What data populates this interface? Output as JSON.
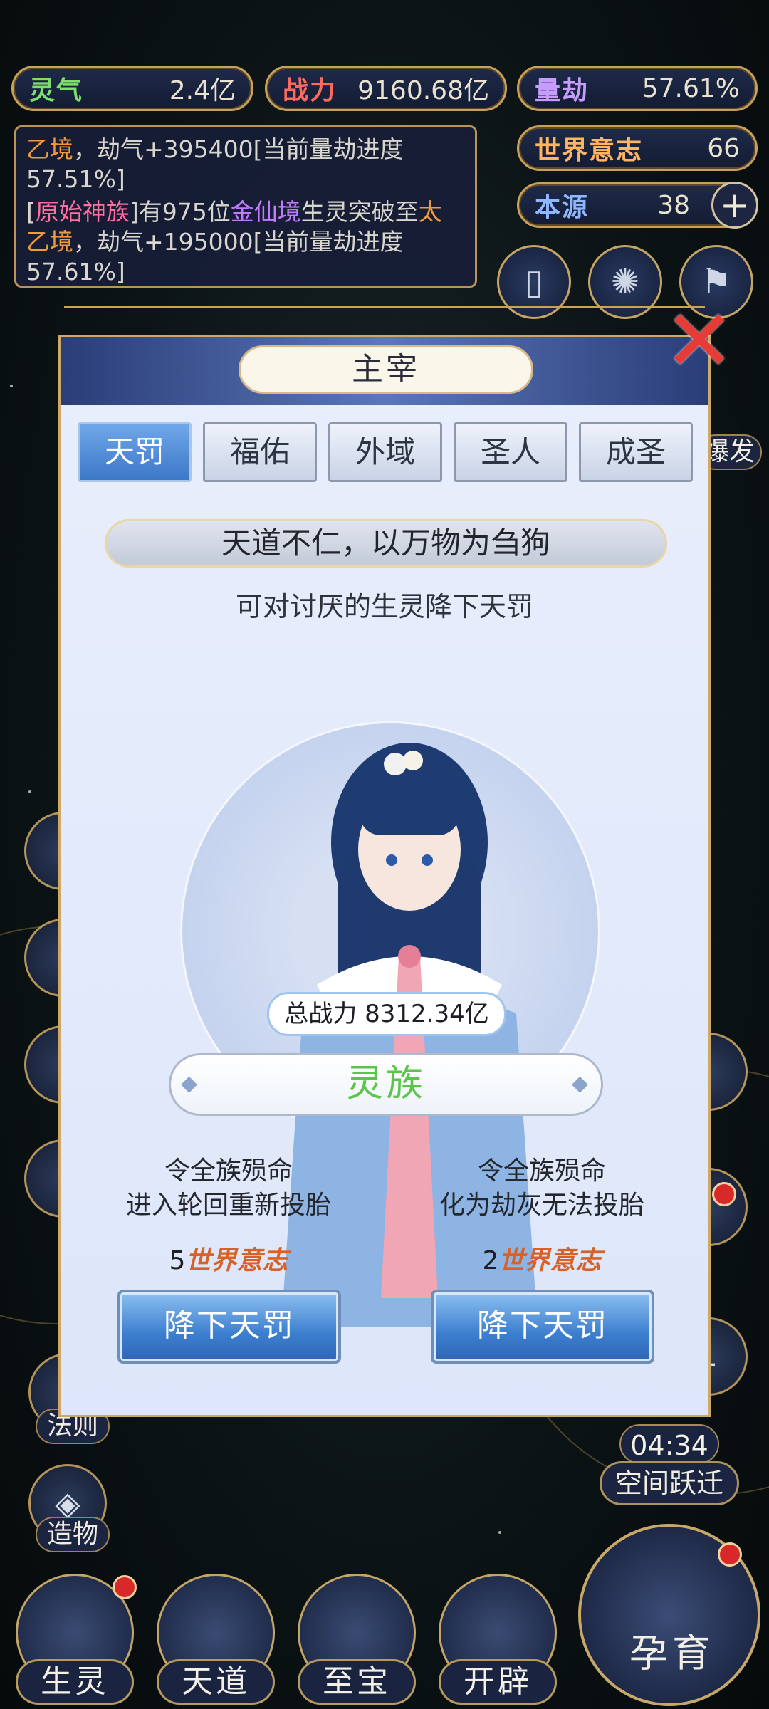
{
  "resources": {
    "lingqi": {
      "label": "灵气",
      "value": "2.4亿"
    },
    "zhanli": {
      "label": "战力",
      "value": "9160.68亿"
    },
    "liangjie": {
      "label": "量劫",
      "value": "57.61%"
    },
    "shijie_yizhi": {
      "label": "世界意志",
      "value": "66"
    },
    "benyuan": {
      "label": "本源",
      "value": "38"
    }
  },
  "log": {
    "line1_a": "乙境",
    "line1_b": "，劫气+395400[当前量劫进度57.51%]",
    "line2_a": "[",
    "line2_b": "原始神族",
    "line2_c": "]有975位",
    "line2_d": "金仙境",
    "line2_e": "生灵突破至",
    "line2_f": "太乙境",
    "line2_g": "，劫气+195000[当前量劫进度57.61%]"
  },
  "side": {
    "right_partial": "爆发",
    "fa_ze": "法则",
    "zao_wu": "造物",
    "kong_jian": "空间跃迁",
    "timer": "04:34",
    "badge_one": "1"
  },
  "modal": {
    "title": "主宰",
    "tabs": [
      "天罚",
      "福佑",
      "外域",
      "圣人",
      "成圣"
    ],
    "active_tab": "天罚",
    "motto": "天道不仁，以万物为刍狗",
    "description": "可对讨厌的生灵降下天罚",
    "power": "总战力 8312.34亿",
    "race": "灵族",
    "option_left": {
      "line1": "令全族殒命",
      "line2": "进入轮回重新投胎",
      "cost_num": "5",
      "cost_unit": "世界意志",
      "button": "降下天罚"
    },
    "option_right": {
      "line1": "令全族殒命",
      "line2": "化为劫灰无法投胎",
      "cost_num": "2",
      "cost_unit": "世界意志",
      "button": "降下天罚"
    }
  },
  "bottom_nav": [
    "生灵",
    "天道",
    "至宝",
    "开辟"
  ],
  "big_button": "孕育",
  "colors": {
    "accent_gold": "#c9a15a",
    "tab_active": "#3d78c8",
    "race_green": "#5bc44a",
    "close_red": "#e63b36"
  }
}
